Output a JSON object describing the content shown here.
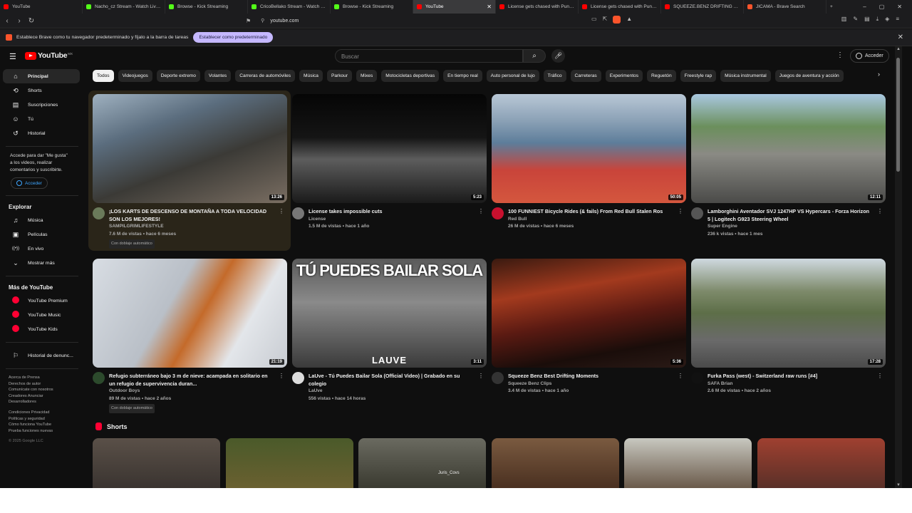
{
  "tabs": [
    {
      "title": "YouTube",
      "color": "#ff0000"
    },
    {
      "title": "Nacho_cz Stream - Watch Live on Kick",
      "color": "#53fc18"
    },
    {
      "title": "Browse - Kick Streaming",
      "color": "#53fc18"
    },
    {
      "title": "CricoBellako Stream - Watch Live on Kick",
      "color": "#53fc18"
    },
    {
      "title": "Browse - Kick Streaming",
      "color": "#53fc18"
    },
    {
      "title": "YouTube",
      "color": "#ff0000",
      "active": true
    },
    {
      "title": "License gets chased with Punchme...",
      "color": "#ff0000"
    },
    {
      "title": "License gets chased with Punchme...",
      "color": "#ff0000"
    },
    {
      "title": "SQUEEZE.BENZ DRIFTING on TIKT...",
      "color": "#ff0000"
    },
    {
      "title": "JICAMA - Brave Search",
      "color": "#fb542b"
    }
  ],
  "address": {
    "url": "youtube.com"
  },
  "infobar": {
    "message": "Establece Brave como tu navegador predeterminado y fíjalo a la barra de tareas",
    "button": "Establecer como predeterminado"
  },
  "header": {
    "logo": "YouTube",
    "country": "MX",
    "search_placeholder": "Buscar",
    "signin": "Acceder"
  },
  "sidebar": {
    "main": [
      {
        "label": "Principal",
        "icon": "home-icon",
        "glyph": "⌂",
        "active": true
      },
      {
        "label": "Shorts",
        "icon": "shorts-icon",
        "glyph": "⟲"
      },
      {
        "label": "Suscripciones",
        "icon": "subscriptions-icon",
        "glyph": "▤"
      },
      {
        "label": "Tú",
        "icon": "you-icon",
        "glyph": "☺"
      },
      {
        "label": "Historial",
        "icon": "history-icon",
        "glyph": "↺"
      }
    ],
    "login_prompt": "Accede para dar \"Me gusta\" a los videos, realizar comentarios y suscribirte.",
    "login_button": "Acceder",
    "explore_title": "Explorar",
    "explore": [
      {
        "label": "Música",
        "icon": "music-icon",
        "glyph": "♫"
      },
      {
        "label": "Películas",
        "icon": "movies-icon",
        "glyph": "▣"
      },
      {
        "label": "En vivo",
        "icon": "live-icon",
        "glyph": "((•))"
      },
      {
        "label": "Mostrar más",
        "icon": "chevron-down-icon",
        "glyph": "⌄"
      }
    ],
    "more_title": "Más de YouTube",
    "more": [
      {
        "label": "YouTube Premium"
      },
      {
        "label": "YouTube Music"
      },
      {
        "label": "YouTube Kids"
      }
    ],
    "report": "Historial de denunc...",
    "footer1": "Acerca de  Prensa\nDerechos de autor\nComunícate con nosotros\nCreadores  Anunciar\nDesarrolladores",
    "footer2": "Condiciones  Privacidad\nPolíticas y seguridad\nCómo funciona YouTube\nPrueba funciones nuevas",
    "copyright": "© 2025 Google LLC"
  },
  "chips": [
    "Todos",
    "Videojuegos",
    "Deporte extremo",
    "Volantes",
    "Carreras de automóviles",
    "Música",
    "Parkour",
    "Mixes",
    "Motocicletas deportivas",
    "En tiempo real",
    "Auto personal de lujo",
    "Tráfico",
    "Carreteras",
    "Experimentos",
    "Reguetón",
    "Freestyle rap",
    "Música instrumental",
    "Juegos de aventura y acción"
  ],
  "videos": [
    {
      "title": "¡LOS KARTS DE DESCENSO DE MONTAÑA A TODA VELOCIDAD SON LOS MEJORES!",
      "channel": "SAMPILGRIMLIFESTYLE",
      "info": "7.6 M de vistas • hace 6 meses",
      "duration": "13:26",
      "dub": "Con doblaje automático",
      "avatar": "#6a7a5a",
      "grad": "linear-gradient(160deg,#9fb1c0 0%,#5b6d7e 30%,#3b3a36 60%,#7a6e62 100%)"
    },
    {
      "title": "License takes impossible cuts",
      "channel": "License",
      "info": "1.5 M de vistas • hace 1 año",
      "duration": "5:23",
      "avatar": "#777",
      "grad": "linear-gradient(180deg,#050505 0%,#151515 40%,#5d5d5d 60%,#1a1a1a 100%)"
    },
    {
      "title": "100 FUNNIEST Bicycle Rides (& fails) From Red Bull Stalen Ros",
      "channel": "Red Bull",
      "info": "26 M de vistas • hace 6 meses",
      "duration": "50:05",
      "avatar": "#c8102e",
      "grad": "linear-gradient(180deg,#b9c8d6 0%,#8aa0b5 25%,#5d7d9a 45%,#c9443a 70%,#d4573e 100%)"
    },
    {
      "title": "Lamborghini Aventador SVJ 1247HP VS Hypercars - Forza Horizon 5 | Logitech G923 Steering Wheel",
      "channel": "Super Engine",
      "info": "236 k vistas • hace 1 mes",
      "duration": "12:11",
      "avatar": "#555",
      "grad": "linear-gradient(180deg,#a9c8e0 0%,#6b8f5c 30%,#8a8a84 55%,#4a4a48 100%)"
    },
    {
      "title": "Refugio subterráneo bajo 3 m de nieve: acampada en solitario en un refugio de supervivencia duran...",
      "channel": "Outdoor Boys",
      "info": "89 M de vistas • hace 2 años",
      "duration": "21:19",
      "dub": "Con doblaje automático",
      "avatar": "#2c4a2c",
      "grad": "linear-gradient(120deg,#d8dde3 0%,#b9bfc7 40%,#c46a2a 55%,#e3e6ea 75%,#c8ccd2 100%)"
    },
    {
      "title": "LaUve - Tú Puedes Bailar Sola (Official Video) | Grabado en su colegio",
      "channel": "LaUve",
      "info": "556 vistas • hace 14 horas",
      "duration": "3:11",
      "avatar": "#ddd",
      "grad": "linear-gradient(180deg,#5a5a5a 0%,#8a8a8a 40%,#3a3a3a 100%)",
      "overlay": "TÚ PUEDES BAILAR SOLA",
      "brand": "LAUVE"
    },
    {
      "title": "Squeeze Benz Best Drifting Moments",
      "channel": "Squeeze Benz Clips",
      "info": "3.4 M de vistas • hace 1 año",
      "duration": "5:36",
      "avatar": "#333",
      "grad": "linear-gradient(170deg,#3a1a10 0%,#a33a1e 30%,#5a1a12 55%,#1a0d0a 80%,#2a1a16 100%)"
    },
    {
      "title": "Furka Pass (west) - Switzerland raw runs [#4]",
      "channel": "SAFA Brian",
      "info": "2.6 M de vistas • hace 2 años",
      "duration": "17:28",
      "avatar": "#111",
      "grad": "linear-gradient(180deg,#cfd9e0 0%,#7d8a6a 30%,#5d6e48 50%,#6a6a6a 75%,#4a4a4a 100%)"
    }
  ],
  "shorts_title": "Shorts",
  "shorts": [
    {
      "grad": "linear-gradient(180deg,#5a5048,#3a3430)"
    },
    {
      "grad": "linear-gradient(180deg,#4a5a2a,#6a6030)"
    },
    {
      "grad": "linear-gradient(180deg,#6a6a60,#3a3a30)",
      "caption": "Juris_Covs"
    },
    {
      "grad": "linear-gradient(180deg,#7a5a40,#4a3020)"
    },
    {
      "grad": "linear-gradient(180deg,#c8c8c0,#6a5a4a)"
    },
    {
      "grad": "linear-gradient(180deg,#a04030,#5a3028)"
    }
  ]
}
